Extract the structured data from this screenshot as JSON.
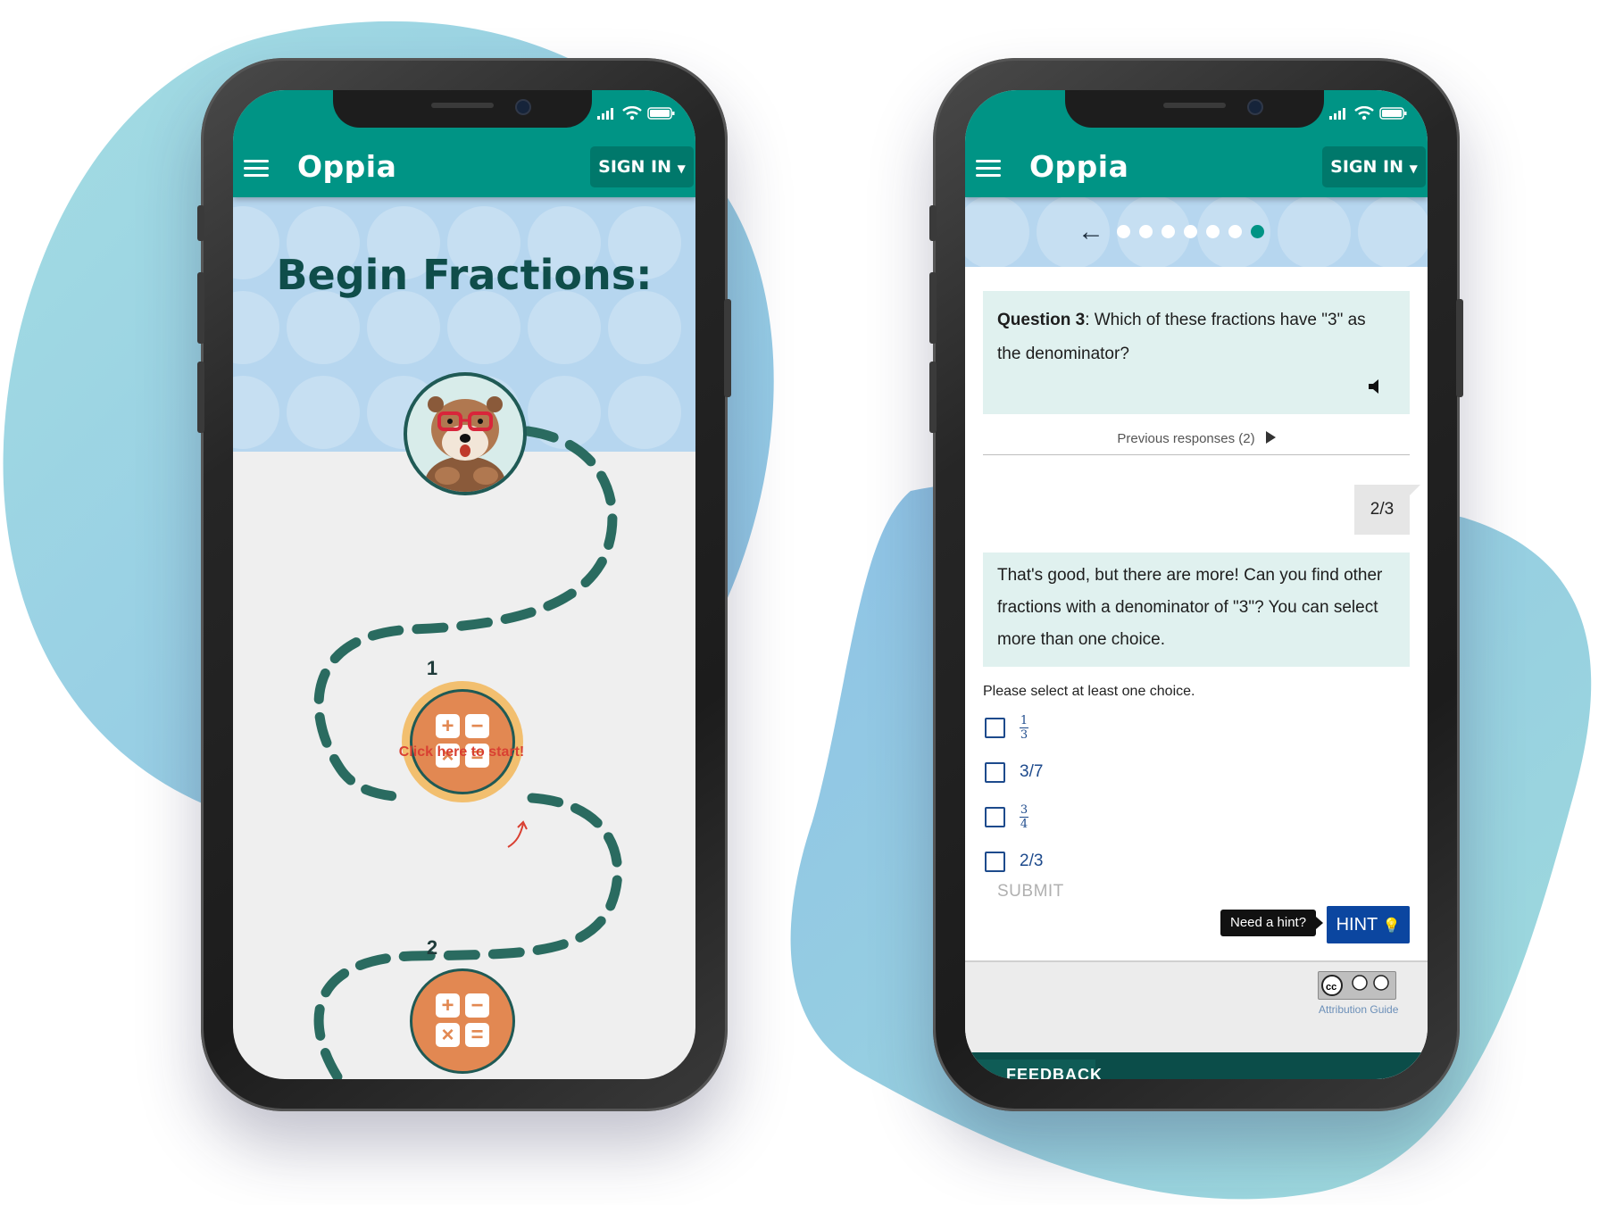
{
  "brand": {
    "logo_text": "Oppia",
    "primary_color": "#009485",
    "accent_color": "#0b46a0",
    "band_color": "#b6d6ef"
  },
  "left_phone": {
    "header": {
      "menu_icon": "hamburger-icon",
      "signin_label": "SIGN IN"
    },
    "title": "Begin Fractions:",
    "nodes": [
      {
        "number": "1",
        "icon": "calculator-icon"
      },
      {
        "number": "2",
        "icon": "calculator-icon"
      }
    ],
    "click_hint": "Click here to start!"
  },
  "right_phone": {
    "header": {
      "menu_icon": "hamburger-icon",
      "signin_label": "SIGN IN"
    },
    "progress": {
      "total_dots": 7,
      "active_dot": 7
    },
    "question": {
      "label": "Question 3",
      "text": ": Which of these fractions have \"3\" as the denominator?"
    },
    "previous_responses": "Previous responses (2)",
    "learner_answer": "2/3",
    "feedback": "That's good, but there are more! Can you find other fractions with a denominator of \"3\"? You can select more than one choice.",
    "instruction": "Please select at least one choice.",
    "choices": [
      {
        "type": "fraction",
        "numerator": "1",
        "denominator": "3"
      },
      {
        "type": "text",
        "label": "3/7"
      },
      {
        "type": "fraction",
        "numerator": "3",
        "denominator": "4"
      },
      {
        "type": "text",
        "label": "2/3"
      }
    ],
    "submit_label": "SUBMIT",
    "hint_tooltip": "Need a hint?",
    "hint_label": "HINT",
    "attribution": "Attribution Guide",
    "feedback_tab": "FEEDBACK"
  }
}
